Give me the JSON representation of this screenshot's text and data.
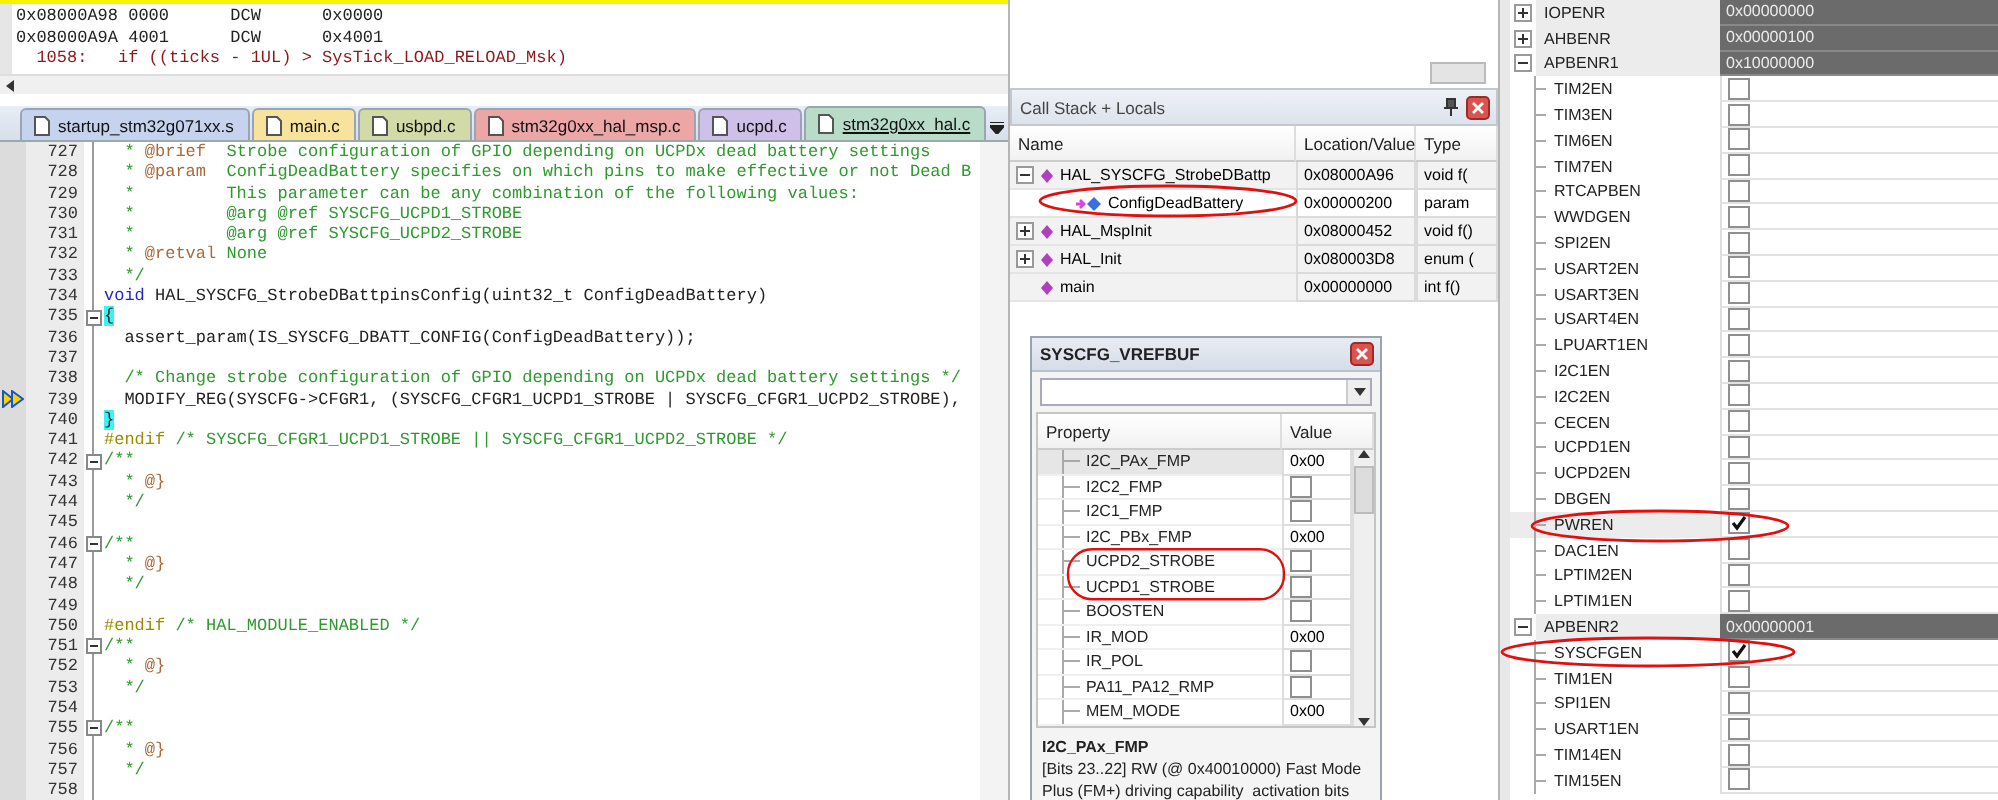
{
  "disassembly": [
    {
      "kind": "asm",
      "text": "0x08000A98 0000      DCW      0x0000"
    },
    {
      "kind": "asm",
      "text": "0x08000A9A 4001      DCW      0x4001"
    },
    {
      "kind": "source",
      "text": "  1058:   if ((ticks - 1UL) > SysTick_LOAD_RELOAD_Msk)"
    }
  ],
  "editor": {
    "tabs": [
      {
        "label": "startup_stm32g071xx.s",
        "color": "#c5d3ee",
        "selected": false
      },
      {
        "label": "main.c",
        "color": "#f7e39c",
        "selected": false
      },
      {
        "label": "usbpd.c",
        "color": "#d2dba8",
        "selected": false
      },
      {
        "label": "stm32g0xx_hal_msp.c",
        "color": "#eca6a6",
        "selected": false
      },
      {
        "label": "ucpd.c",
        "color": "#cfc0ea",
        "selected": false
      },
      {
        "label": "stm32g0xx_hal.c",
        "color": "#b9dcc9",
        "selected": true
      }
    ],
    "lines": [
      {
        "number": "727",
        "fold": false,
        "current": false,
        "segments": [
          {
            "kind": "comment",
            "text": "  * "
          },
          {
            "kind": "tag",
            "text": "@brief"
          },
          {
            "kind": "comment",
            "text": "  Strobe configuration of GPIO depending on UCPDx dead battery settings"
          }
        ]
      },
      {
        "number": "728",
        "fold": false,
        "current": false,
        "segments": [
          {
            "kind": "comment",
            "text": "  * "
          },
          {
            "kind": "tag",
            "text": "@param"
          },
          {
            "kind": "comment",
            "text": "  ConfigDeadBattery specifies on which pins to make effective or not Dead B"
          }
        ]
      },
      {
        "number": "729",
        "fold": false,
        "current": false,
        "segments": [
          {
            "kind": "comment",
            "text": "  *         This parameter can be any combination of the following values:"
          }
        ]
      },
      {
        "number": "730",
        "fold": false,
        "current": false,
        "segments": [
          {
            "kind": "comment",
            "text": "  *         @arg @ref SYSCFG_UCPD1_STROBE"
          }
        ]
      },
      {
        "number": "731",
        "fold": false,
        "current": false,
        "segments": [
          {
            "kind": "comment",
            "text": "  *         @arg @ref SYSCFG_UCPD2_STROBE"
          }
        ]
      },
      {
        "number": "732",
        "fold": false,
        "current": false,
        "segments": [
          {
            "kind": "comment",
            "text": "  * "
          },
          {
            "kind": "tag",
            "text": "@retval"
          },
          {
            "kind": "comment",
            "text": " None"
          }
        ]
      },
      {
        "number": "733",
        "fold": false,
        "current": false,
        "segments": [
          {
            "kind": "comment",
            "text": "  */"
          }
        ]
      },
      {
        "number": "734",
        "fold": false,
        "current": false,
        "segments": [
          {
            "kind": "keyword",
            "text": "void"
          },
          {
            "kind": "text",
            "text": " HAL_SYSCFG_StrobeDBattpinsConfig(uint32_t ConfigDeadBattery)"
          }
        ]
      },
      {
        "number": "735",
        "fold": true,
        "current": false,
        "segments": [
          {
            "kind": "brace",
            "text": "{"
          }
        ]
      },
      {
        "number": "736",
        "fold": false,
        "current": false,
        "segments": [
          {
            "kind": "text",
            "text": "  assert_param(IS_SYSCFG_DBATT_CONFIG(ConfigDeadBattery));"
          }
        ]
      },
      {
        "number": "737",
        "fold": false,
        "current": false
      },
      {
        "number": "738",
        "fold": false,
        "current": false,
        "segments": [
          {
            "kind": "comment",
            "text": "  /* Change strobe configuration of GPIO depending on UCPDx dead battery settings */"
          }
        ]
      },
      {
        "number": "739",
        "fold": false,
        "current": true,
        "segments": [
          {
            "kind": "text",
            "text": "  MODIFY_REG(SYSCFG->CFGR1, (SYSCFG_CFGR1_UCPD1_STROBE | SYSCFG_CFGR1_UCPD2_STROBE),"
          }
        ]
      },
      {
        "number": "740",
        "fold": false,
        "current": false,
        "segments": [
          {
            "kind": "brace",
            "text": "}"
          }
        ]
      },
      {
        "number": "741",
        "fold": false,
        "current": false,
        "segments": [
          {
            "kind": "preproc",
            "text": "#endif"
          },
          {
            "kind": "comment",
            "text": " /* SYSCFG_CFGR1_UCPD1_STROBE || SYSCFG_CFGR1_UCPD2_STROBE */"
          }
        ]
      },
      {
        "number": "742",
        "fold": true,
        "current": false,
        "segments": [
          {
            "kind": "comment",
            "text": "/**"
          }
        ]
      },
      {
        "number": "743",
        "fold": false,
        "current": false,
        "segments": [
          {
            "kind": "comment",
            "text": "  * "
          },
          {
            "kind": "tag",
            "text": "@}"
          }
        ]
      },
      {
        "number": "744",
        "fold": false,
        "current": false,
        "segments": [
          {
            "kind": "comment",
            "text": "  */"
          }
        ]
      },
      {
        "number": "745",
        "fold": false,
        "current": false
      },
      {
        "number": "746",
        "fold": true,
        "current": false,
        "segments": [
          {
            "kind": "comment",
            "text": "/**"
          }
        ]
      },
      {
        "number": "747",
        "fold": false,
        "current": false,
        "segments": [
          {
            "kind": "comment",
            "text": "  * "
          },
          {
            "kind": "tag",
            "text": "@}"
          }
        ]
      },
      {
        "number": "748",
        "fold": false,
        "current": false,
        "segments": [
          {
            "kind": "comment",
            "text": "  */"
          }
        ]
      },
      {
        "number": "749",
        "fold": false,
        "current": false
      },
      {
        "number": "750",
        "fold": false,
        "current": false,
        "segments": [
          {
            "kind": "preproc",
            "text": "#endif"
          },
          {
            "kind": "comment",
            "text": " /* HAL_MODULE_ENABLED */"
          }
        ]
      },
      {
        "number": "751",
        "fold": true,
        "current": false,
        "segments": [
          {
            "kind": "comment",
            "text": "/**"
          }
        ]
      },
      {
        "number": "752",
        "fold": false,
        "current": false,
        "segments": [
          {
            "kind": "comment",
            "text": "  * "
          },
          {
            "kind": "tag",
            "text": "@}"
          }
        ]
      },
      {
        "number": "753",
        "fold": false,
        "current": false,
        "segments": [
          {
            "kind": "comment",
            "text": "  */"
          }
        ]
      },
      {
        "number": "754",
        "fold": false,
        "current": false
      },
      {
        "number": "755",
        "fold": true,
        "current": false,
        "segments": [
          {
            "kind": "comment",
            "text": "/**"
          }
        ]
      },
      {
        "number": "756",
        "fold": false,
        "current": false,
        "segments": [
          {
            "kind": "comment",
            "text": "  * "
          },
          {
            "kind": "tag",
            "text": "@}"
          }
        ]
      },
      {
        "number": "757",
        "fold": false,
        "current": false,
        "segments": [
          {
            "kind": "comment",
            "text": "  */"
          }
        ]
      },
      {
        "number": "758",
        "fold": false,
        "current": false
      }
    ]
  },
  "call_stack": {
    "title": "Call Stack + Locals",
    "columns": [
      "Name",
      "Location/Value",
      "Type"
    ],
    "rows": [
      {
        "kind": "function",
        "name": "HAL_SYSCFG_StrobeDBattp",
        "value": "0x08000A96",
        "type": "void f(",
        "expanded": true,
        "selected": false,
        "children": [
          {
            "kind": "parameter",
            "name": "ConfigDeadBattery",
            "value": "0x00000200",
            "type": "param",
            "selected": true
          }
        ]
      },
      {
        "kind": "function",
        "name": "HAL_MspInit",
        "value": "0x08000452",
        "type": "void f()",
        "expanded": false,
        "selected": false
      },
      {
        "kind": "function",
        "name": "HAL_Init",
        "value": "0x080003D8",
        "type": "enum (",
        "expanded": false,
        "selected": false
      },
      {
        "kind": "function",
        "name": "main",
        "value": "0x00000000",
        "type": "int f()",
        "selected": false
      }
    ]
  },
  "peripheral_window": {
    "title": "SYSCFG_VREFBUF",
    "columns": [
      "Property",
      "Value"
    ],
    "rows": [
      {
        "kind": "value",
        "name": "I2C_PAx_FMP",
        "value": "0x00",
        "selected": true
      },
      {
        "kind": "checkbox",
        "name": "I2C2_FMP",
        "checked": false,
        "selected": false
      },
      {
        "kind": "checkbox",
        "name": "I2C1_FMP",
        "checked": false,
        "selected": false
      },
      {
        "kind": "value",
        "name": "I2C_PBx_FMP",
        "value": "0x00",
        "selected": false
      },
      {
        "kind": "checkbox",
        "name": "UCPD2_STROBE",
        "checked": false,
        "selected": false
      },
      {
        "kind": "checkbox",
        "name": "UCPD1_STROBE",
        "checked": false,
        "selected": false
      },
      {
        "kind": "checkbox",
        "name": "BOOSTEN",
        "checked": false,
        "selected": false
      },
      {
        "kind": "value",
        "name": "IR_MOD",
        "value": "0x00",
        "selected": false
      },
      {
        "kind": "checkbox",
        "name": "IR_POL",
        "checked": false,
        "selected": false
      },
      {
        "kind": "checkbox",
        "name": "PA11_PA12_RMP",
        "checked": false,
        "selected": false
      },
      {
        "kind": "value",
        "name": "MEM_MODE",
        "value": "0x00",
        "selected": false
      }
    ],
    "description": {
      "title": "I2C_PAx_FMP",
      "text": "[Bits 23..22] RW (@ 0x40010000) Fast Mode Plus (FM+) driving capability  activation bits"
    }
  },
  "registers": {
    "rows": [
      {
        "name": "IOPENR",
        "value": "0x00000000",
        "expanded": false
      },
      {
        "name": "AHBENR",
        "value": "0x00000100",
        "expanded": false
      },
      {
        "name": "APBENR1",
        "value": "0x10000000",
        "expanded": true,
        "children": [
          {
            "name": "TIM2EN",
            "checked": false,
            "selected": false
          },
          {
            "name": "TIM3EN",
            "checked": false,
            "selected": false
          },
          {
            "name": "TIM6EN",
            "checked": false,
            "selected": false
          },
          {
            "name": "TIM7EN",
            "checked": false,
            "selected": false
          },
          {
            "name": "RTCAPBEN",
            "checked": false,
            "selected": false
          },
          {
            "name": "WWDGEN",
            "checked": false,
            "selected": false
          },
          {
            "name": "SPI2EN",
            "checked": false,
            "selected": false
          },
          {
            "name": "USART2EN",
            "checked": false,
            "selected": false
          },
          {
            "name": "USART3EN",
            "checked": false,
            "selected": false
          },
          {
            "name": "USART4EN",
            "checked": false,
            "selected": false
          },
          {
            "name": "LPUART1EN",
            "checked": false,
            "selected": false
          },
          {
            "name": "I2C1EN",
            "checked": false,
            "selected": false
          },
          {
            "name": "I2C2EN",
            "checked": false,
            "selected": false
          },
          {
            "name": "CECEN",
            "checked": false,
            "selected": false
          },
          {
            "name": "UCPD1EN",
            "checked": false,
            "selected": false
          },
          {
            "name": "UCPD2EN",
            "checked": false,
            "selected": false
          },
          {
            "name": "DBGEN",
            "checked": false,
            "selected": false
          },
          {
            "name": "PWREN",
            "checked": true,
            "selected": true
          },
          {
            "name": "DAC1EN",
            "checked": false,
            "selected": false
          },
          {
            "name": "LPTIM2EN",
            "checked": false,
            "selected": false
          },
          {
            "name": "LPTIM1EN",
            "checked": false,
            "selected": false
          }
        ]
      },
      {
        "name": "APBENR2",
        "value": "0x00000001",
        "expanded": true,
        "children": [
          {
            "name": "SYSCFGEN",
            "checked": true,
            "selected": false
          },
          {
            "name": "TIM1EN",
            "checked": false,
            "selected": false
          },
          {
            "name": "SPI1EN",
            "checked": false,
            "selected": false
          },
          {
            "name": "USART1EN",
            "checked": false,
            "selected": false
          },
          {
            "name": "TIM14EN",
            "checked": false,
            "selected": false
          },
          {
            "name": "TIM15EN",
            "checked": false,
            "selected": false
          }
        ]
      }
    ]
  }
}
